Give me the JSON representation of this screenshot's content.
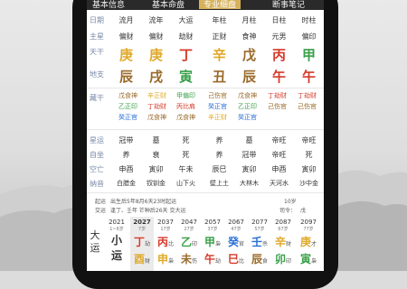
{
  "tabs": [
    "基本信息",
    "基本命盘",
    "专业细盘",
    "断事笔记"
  ],
  "header_row": {
    "label": "日期",
    "cols": [
      "流月",
      "流年",
      "大运",
      "年柱",
      "月柱",
      "日柱",
      "时柱"
    ]
  },
  "zhuxing": {
    "label": "主星",
    "cols": [
      "偏财",
      "偏财",
      "劫财",
      "正财",
      "食神",
      "元男",
      "偏印"
    ]
  },
  "tiangan": {
    "label": "天干",
    "cols": [
      "庚",
      "庚",
      "丁",
      "辛",
      "戊",
      "丙",
      "甲"
    ]
  },
  "dizhi": {
    "label": "地支",
    "cols": [
      "辰",
      "戌",
      "寅",
      "丑",
      "辰",
      "午",
      "午"
    ]
  },
  "canggan_label": "藏干",
  "canggan": [
    [
      "戊食神",
      "乙正印",
      "癸正官"
    ],
    [
      "辛正财",
      "丁劫财",
      "戊食神"
    ],
    [
      "甲偏印",
      "丙比肩",
      "戊食神"
    ],
    [
      "己伤官",
      "癸正官",
      "辛正财"
    ],
    [
      "戊食神",
      "乙正印",
      "癸正官"
    ],
    [
      "丁劫财",
      "己伤官"
    ],
    [
      "丁劫财",
      "己伤官"
    ]
  ],
  "xingyun": {
    "label": "星运",
    "cols": [
      "冠带",
      "墓",
      "死",
      "养",
      "墓",
      "帝旺",
      "帝旺"
    ]
  },
  "zizuo": {
    "label": "自坐",
    "cols": [
      "养",
      "衰",
      "死",
      "养",
      "冠带",
      "帝旺",
      "死"
    ]
  },
  "kongwang": {
    "label": "空亡",
    "cols": [
      "申酉",
      "寅卯",
      "午未",
      "辰巳",
      "寅卯",
      "申酉",
      "寅卯"
    ]
  },
  "nayin": {
    "label": "纳音",
    "cols": [
      "白腊金",
      "钗钏金",
      "山下火",
      "壁上土",
      "大林木",
      "天河水",
      "沙中金"
    ]
  },
  "qiyun": {
    "label": "起运",
    "text": "出生后5年8月6天23时起运",
    "age": "10岁"
  },
  "jiaoyun": {
    "label": "交运",
    "text": "逢丁、壬年 芒种后26天 交大运",
    "siling_label": "司令：",
    "siling": "戊"
  },
  "dayun_label": [
    "大",
    "运"
  ],
  "xiaoyun_label": [
    "小",
    "运"
  ],
  "dayun_cols": [
    {
      "year": "2021",
      "age": "1~6岁",
      "g1": "小",
      "g2": "运",
      "s1": "",
      "s2": ""
    },
    {
      "year": "2027",
      "age": "7岁",
      "g1": "丁",
      "g2": "酉",
      "s1": "劫",
      "s2": "财"
    },
    {
      "year": "2037",
      "age": "17岁",
      "g1": "丙",
      "g2": "申",
      "s1": "比",
      "s2": "枭"
    },
    {
      "year": "2047",
      "age": "27岁",
      "g1": "乙",
      "g2": "未",
      "s1": "印",
      "s2": "伤"
    },
    {
      "year": "2057",
      "age": "37岁",
      "g1": "甲",
      "g2": "午",
      "s1": "枭",
      "s2": "劫"
    },
    {
      "year": "2067",
      "age": "47岁",
      "g1": "癸",
      "g2": "巳",
      "s1": "官",
      "s2": "比"
    },
    {
      "year": "2077",
      "age": "57岁",
      "g1": "壬",
      "g2": "辰",
      "s1": "杀",
      "s2": "食"
    },
    {
      "year": "2087",
      "age": "67岁",
      "g1": "辛",
      "g2": "卯",
      "s1": "财",
      "s2": "印"
    },
    {
      "year": "2097",
      "age": "77岁",
      "g1": "庚",
      "g2": "寅",
      "s1": "才",
      "s2": "枭"
    }
  ]
}
